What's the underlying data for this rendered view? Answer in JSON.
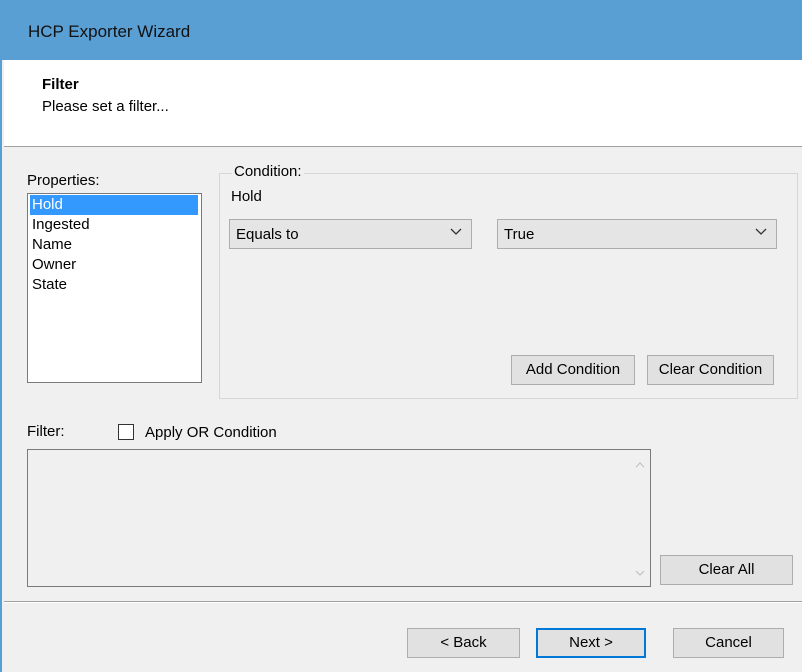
{
  "window": {
    "title": "HCP Exporter Wizard"
  },
  "header": {
    "title": "Filter",
    "subtitle": "Please set a filter..."
  },
  "properties": {
    "label": "Properties:",
    "items": [
      {
        "label": "Hold",
        "selected": true
      },
      {
        "label": "Ingested",
        "selected": false
      },
      {
        "label": "Name",
        "selected": false
      },
      {
        "label": "Owner",
        "selected": false
      },
      {
        "label": "State",
        "selected": false
      }
    ]
  },
  "condition": {
    "legend": "Condition:",
    "property": "Hold",
    "operator": {
      "value": "Equals to",
      "icon": "chevron-down-icon"
    },
    "value": {
      "value": "True",
      "icon": "chevron-down-icon"
    },
    "add_label": "Add Condition",
    "clear_label": "Clear Condition"
  },
  "filter": {
    "label": "Filter:",
    "apply_or_label": "Apply OR Condition",
    "apply_or_checked": false,
    "text": "",
    "clear_all_label": "Clear All"
  },
  "footer": {
    "back_label": "< Back",
    "next_label": "Next >",
    "cancel_label": "Cancel"
  },
  "colors": {
    "titlebar": "#5a9fd4",
    "selection": "#3399ff",
    "default_button_border": "#0078d7"
  }
}
